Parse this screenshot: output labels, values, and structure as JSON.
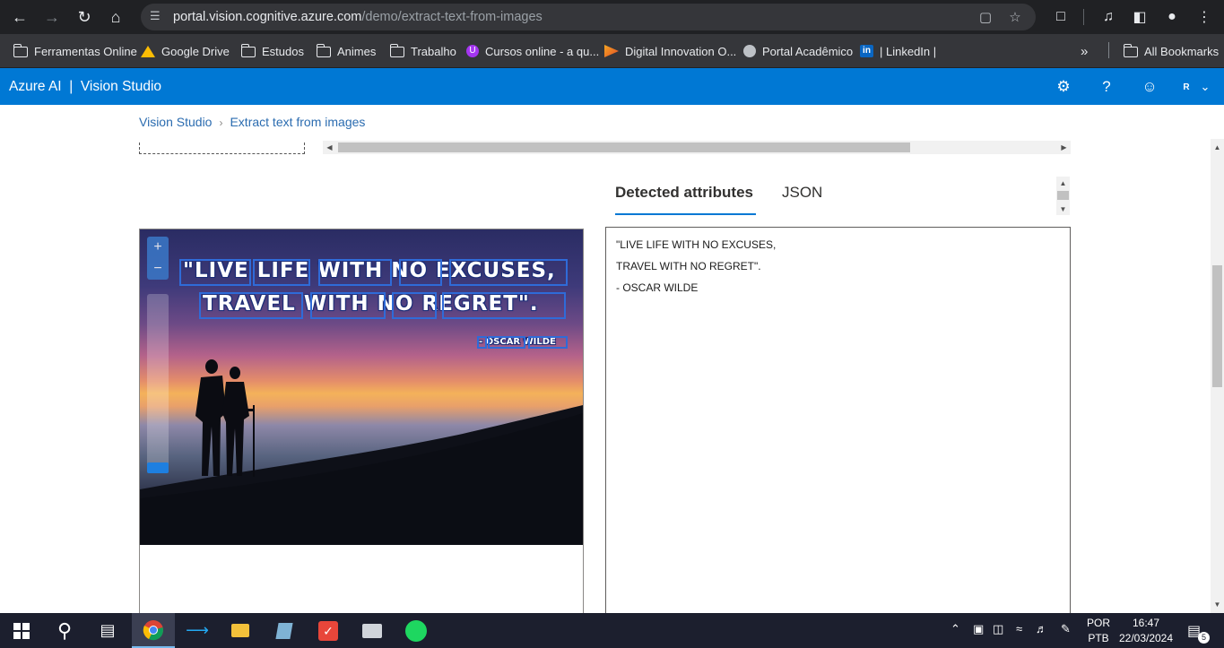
{
  "browser": {
    "url_host": "portal.vision.cognitive.azure.com",
    "url_path": "/demo/extract-text-from-images"
  },
  "bookmarks": [
    {
      "label": "Ferramentas Online",
      "icon": "folder-icon"
    },
    {
      "label": "Google Drive",
      "icon": "google-drive-icon"
    },
    {
      "label": "Estudos",
      "icon": "folder-icon"
    },
    {
      "label": "Animes",
      "icon": "folder-icon"
    },
    {
      "label": "Trabalho",
      "icon": "folder-icon"
    },
    {
      "label": "Cursos online - a qu...",
      "icon": "udemy-icon"
    },
    {
      "label": "Digital Innovation O...",
      "icon": "dio-icon"
    },
    {
      "label": "Portal Acadêmico",
      "icon": "globe-icon"
    },
    {
      "label": "| LinkedIn |",
      "icon": "linkedin-icon"
    }
  ],
  "bookmarks_overflow": "»",
  "all_bookmarks": "All Bookmarks",
  "azure": {
    "title": "Azure AI  |  Vision Studio",
    "user_initial": "R"
  },
  "breadcrumb": {
    "home": "Vision Studio",
    "current": "Extract text from images"
  },
  "tabs": {
    "detected": "Detected attributes",
    "json": "JSON"
  },
  "image_text": {
    "line1": "\"LIVE LIFE WITH NO EXCUSES,",
    "line2": "TRAVEL WITH NO REGRET\".",
    "line3": "- OSCAR WILDE"
  },
  "zoom": {
    "plus": "+",
    "minus": "−"
  },
  "results": {
    "line1": "\"LIVE LIFE WITH NO EXCUSES,",
    "line2": "TRAVEL WITH NO REGRET\".",
    "line3": "- OSCAR WILDE"
  },
  "taskbar": {
    "language_top": "POR",
    "language_bottom": "PTB",
    "time": "16:47",
    "date": "22/03/2024",
    "notifications": "5"
  },
  "colors": {
    "azure_blue": "#0078d4",
    "chrome_dark": "#202124",
    "taskbar": "#1c1f2e",
    "ocr_box": "#2f6bd8"
  }
}
